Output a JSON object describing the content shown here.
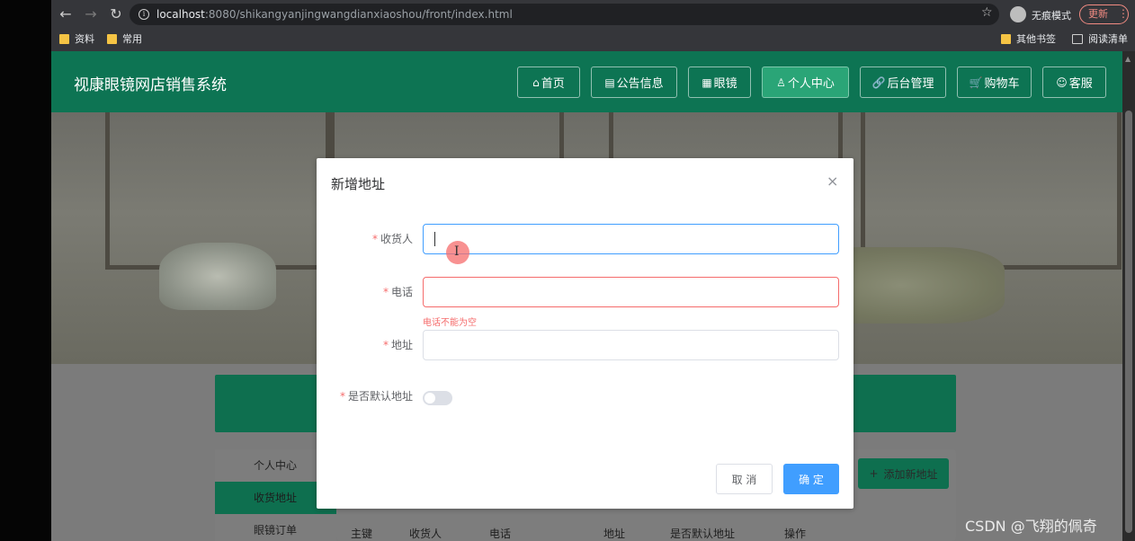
{
  "browser": {
    "url_host": "localhost",
    "url_rest": ":8080/shikangyanjingwangdianxiaoshou/front/index.html",
    "incognito_label": "无痕模式",
    "update_label": "更新",
    "bookmarks": [
      "资料",
      "常用"
    ],
    "bookmarks_right": [
      "其他书签",
      "阅读清单"
    ]
  },
  "site": {
    "title": "视康眼镜网店销售系统",
    "nav": [
      {
        "icon": "⌂",
        "label": "首页"
      },
      {
        "icon": "▤",
        "label": "公告信息"
      },
      {
        "icon": "▦",
        "label": "眼镜"
      },
      {
        "icon": "♙",
        "label": "个人中心"
      },
      {
        "icon": "🔗",
        "label": "后台管理"
      },
      {
        "icon": "🛒",
        "label": "购物车"
      },
      {
        "icon": "☺",
        "label": "客服"
      }
    ]
  },
  "sidebar": {
    "items": [
      "个人中心",
      "收货地址",
      "眼镜订单"
    ]
  },
  "table": {
    "add_label": "添加新地址",
    "columns": [
      "主键",
      "收货人",
      "电话",
      "地址",
      "是否默认地址",
      "操作"
    ]
  },
  "dialog": {
    "title": "新增地址",
    "fields": [
      {
        "label": "收货人",
        "value": ""
      },
      {
        "label": "电话",
        "value": "",
        "error": "电话不能为空"
      },
      {
        "label": "地址",
        "value": ""
      },
      {
        "label": "是否默认地址"
      }
    ],
    "cancel_label": "取 消",
    "ok_label": "确 定"
  },
  "watermark": "CSDN @飞翔的佩奇",
  "colors": {
    "header_green": "#0d7453",
    "active_nav": "#2aa577",
    "primary_blue": "#409eff",
    "error_red": "#f56c6c"
  }
}
